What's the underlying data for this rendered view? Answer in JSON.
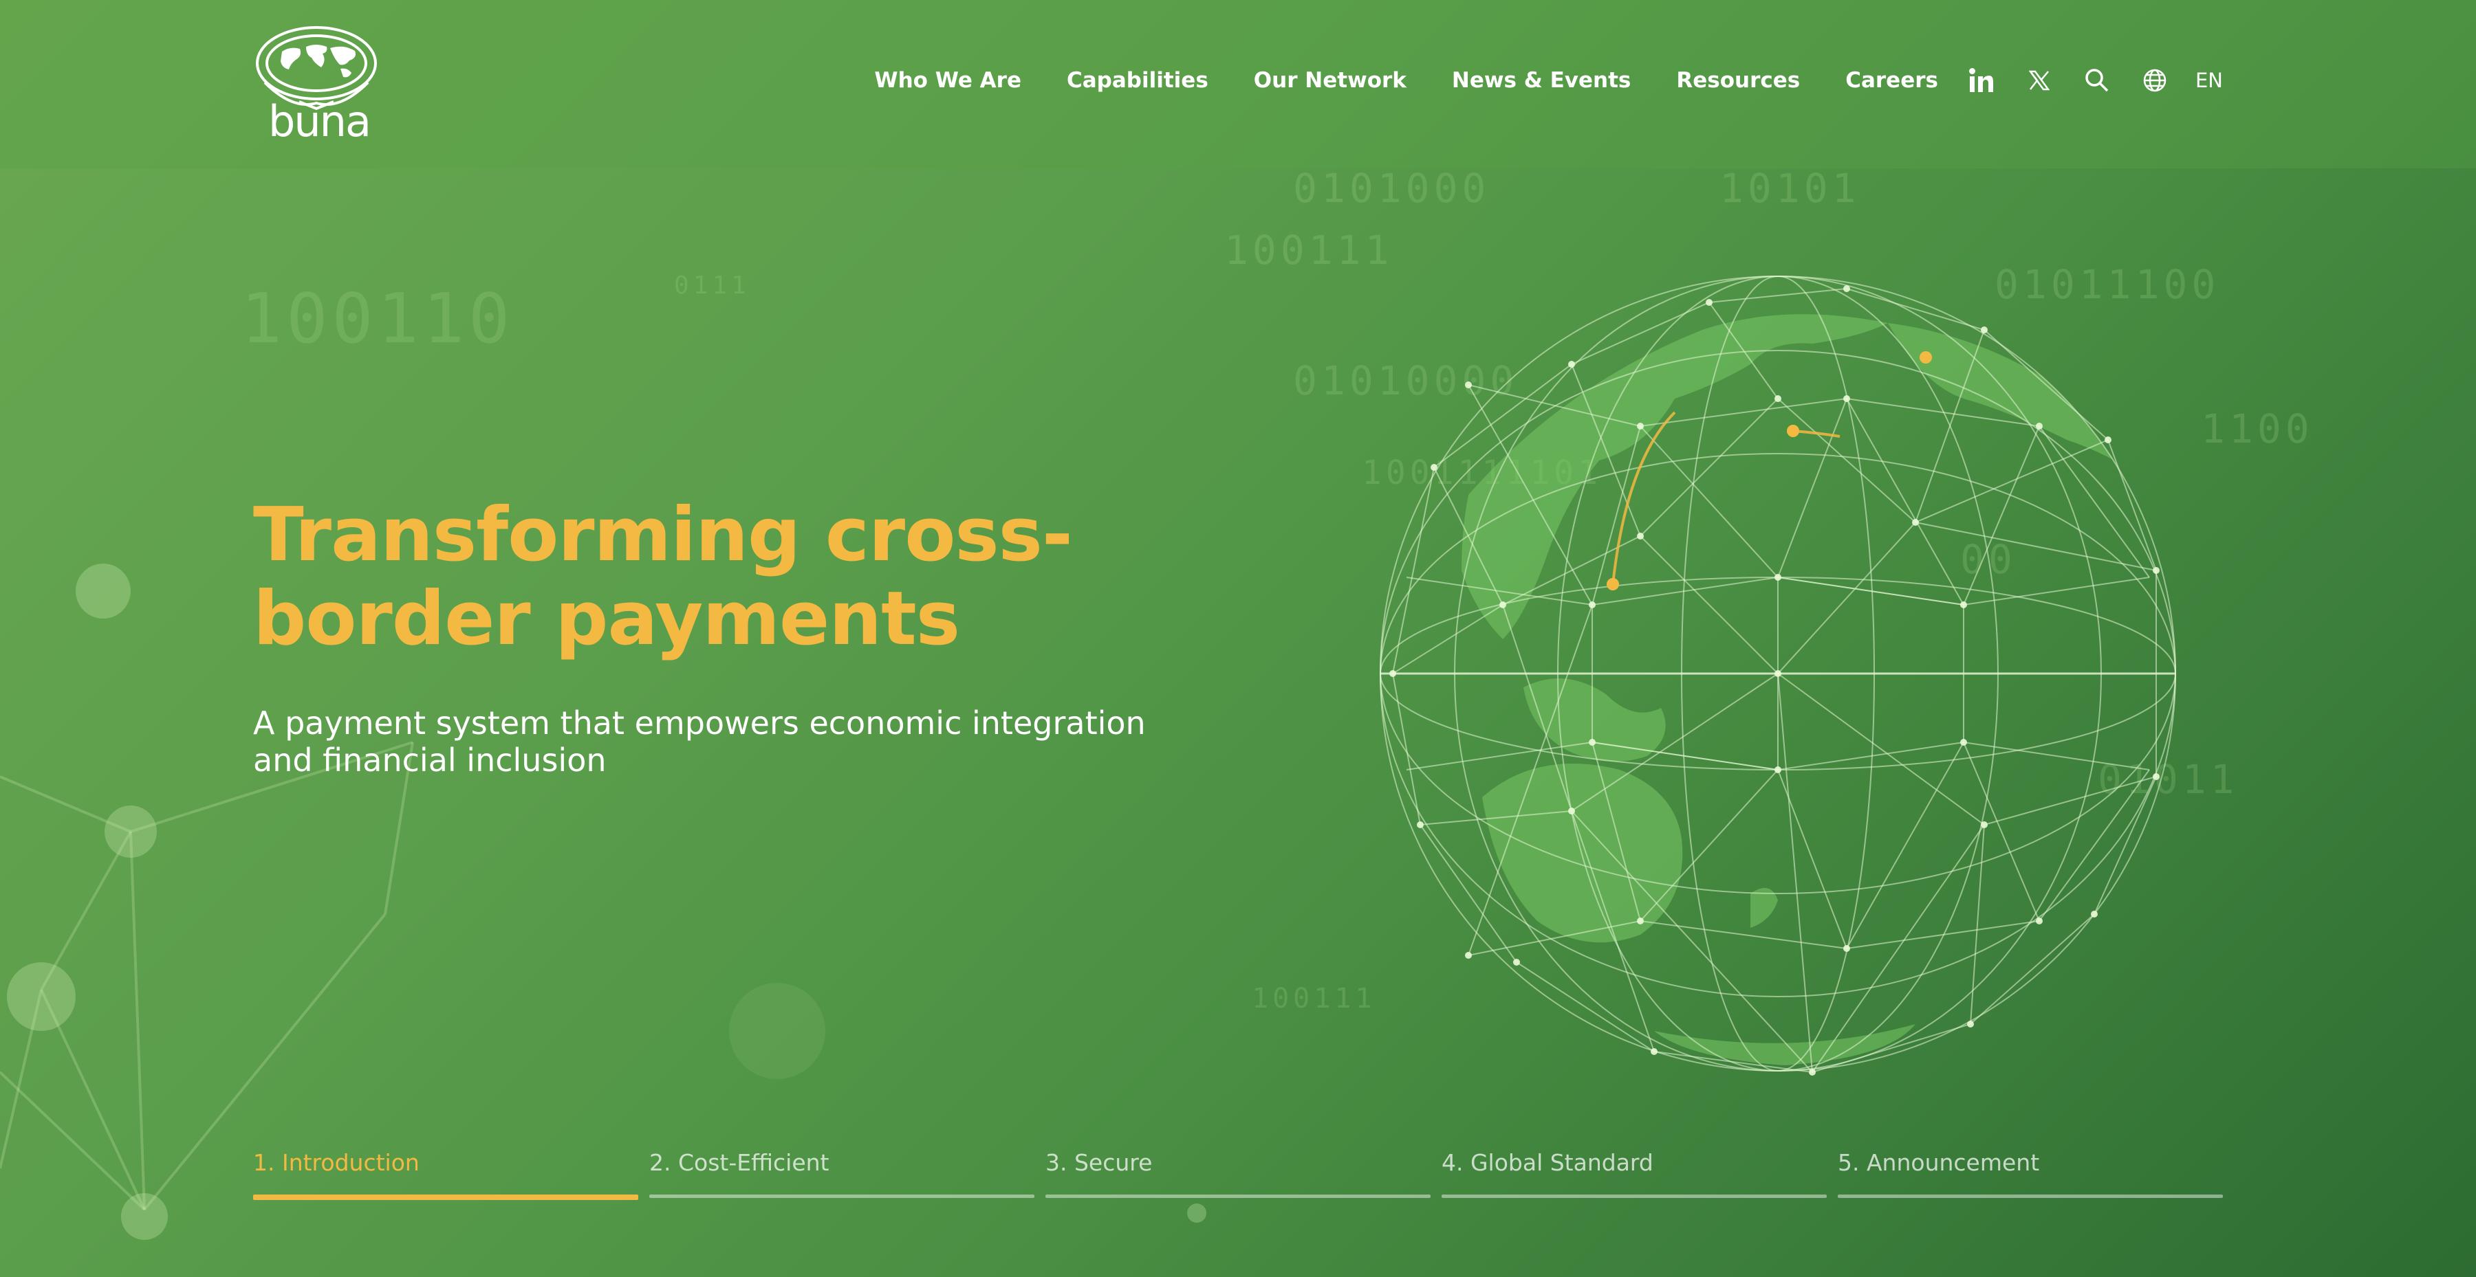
{
  "brand": {
    "logo_text": "buna",
    "accent_color": "#f4b942"
  },
  "nav": {
    "items": [
      {
        "label": "Who We Are"
      },
      {
        "label": "Capabilities"
      },
      {
        "label": "Our Network"
      },
      {
        "label": "News & Events"
      },
      {
        "label": "Resources"
      },
      {
        "label": "Careers"
      }
    ],
    "icons": [
      "linkedin-icon",
      "x-twitter-icon",
      "search-icon",
      "globe-icon"
    ],
    "language": "EN"
  },
  "hero": {
    "title": "Transforming cross-border payments",
    "subtitle": "A payment system that empowers economic integration and financial inclusion"
  },
  "tabs": [
    {
      "label": "1. Introduction",
      "active": true
    },
    {
      "label": "2. Cost-Efficient",
      "active": false
    },
    {
      "label": "3. Secure",
      "active": false
    },
    {
      "label": "4. Global Standard",
      "active": false
    },
    {
      "label": "5. Announcement",
      "active": false
    }
  ],
  "background_binary": [
    "100110",
    "0111",
    "100111",
    "0101000",
    "10101",
    "01011100",
    "00",
    "1001111101",
    "1100",
    "01010000",
    "100111",
    "01011"
  ]
}
